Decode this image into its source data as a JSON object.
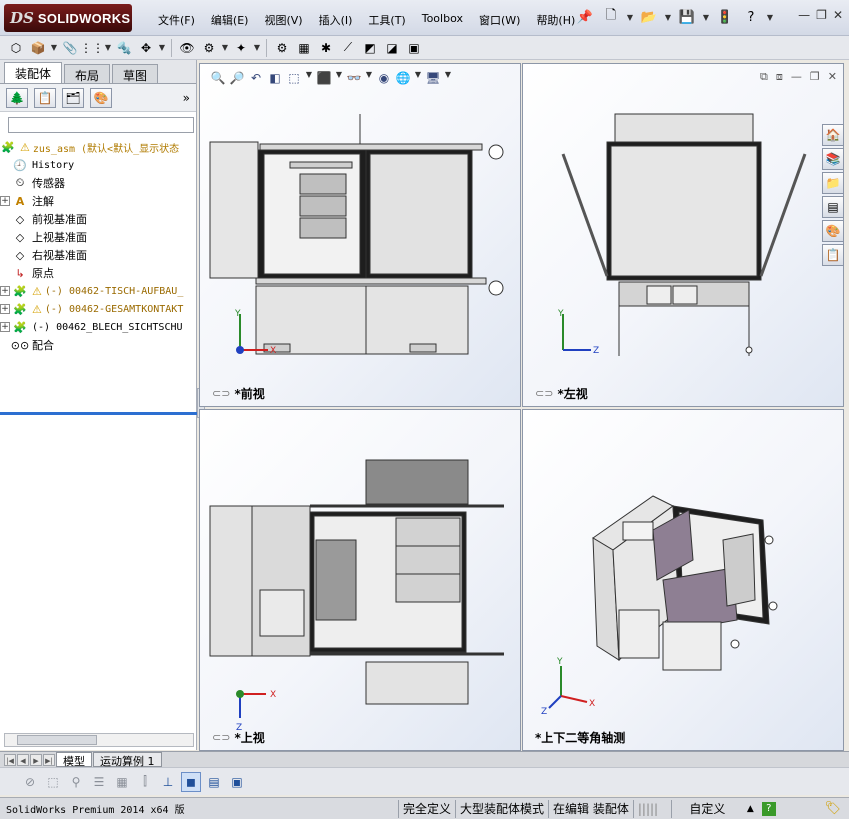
{
  "app": {
    "logo_ds": "DS",
    "logo_text": "SOLIDWORKS",
    "menu": [
      "文件(F)",
      "编辑(E)",
      "视图(V)",
      "插入(I)",
      "工具(T)",
      "Toolbox",
      "窗口(W)",
      "帮助(H)"
    ],
    "title_tool_icons": [
      "pin-icon",
      "new-doc-icon",
      "open-icon",
      "save-icon",
      "traffic-light-icon",
      "help-icon"
    ],
    "window_buttons": [
      "—",
      "❐",
      "✕"
    ]
  },
  "feature_manager": {
    "tabs": [
      "装配体",
      "布局",
      "草图"
    ],
    "active_tab": 0,
    "expand_symbol": "»",
    "tree": [
      {
        "label": "zus_asm  (默认<默认_显示状态",
        "kind": "root",
        "expand": false,
        "warn": true
      },
      {
        "label": "History",
        "kind": "history",
        "expand": false
      },
      {
        "label": "传感器",
        "kind": "sensor",
        "expand": false
      },
      {
        "label": "注解",
        "kind": "annotation",
        "expand": true
      },
      {
        "label": "前视基准面",
        "kind": "plane",
        "expand": false
      },
      {
        "label": "上视基准面",
        "kind": "plane",
        "expand": false
      },
      {
        "label": "右视基准面",
        "kind": "plane",
        "expand": false
      },
      {
        "label": "原点",
        "kind": "origin",
        "expand": false
      },
      {
        "label": "(-) 00462-TISCH-AUFBAU_",
        "kind": "subasm",
        "expand": true,
        "warn": true
      },
      {
        "label": "(-) 00462-GESAMTKONTAKT",
        "kind": "subasm",
        "expand": true,
        "warn": true
      },
      {
        "label": "(-) 00462_BLECH_SICHTSCHU",
        "kind": "subasm2",
        "expand": true,
        "warn": false
      },
      {
        "label": "配合",
        "kind": "mates",
        "expand": false
      }
    ]
  },
  "viewports": {
    "front_label": "*前视",
    "left_label": "*左视",
    "top_label": "*上视",
    "iso_label": "*上下二等角轴测",
    "axis_front": {
      "a": "Y",
      "b": "X"
    },
    "axis_left": {
      "a": "Y",
      "b": "Z"
    },
    "axis_top": {
      "a": "X",
      "b": "Z"
    },
    "axis_iso": {
      "a": "Y",
      "b": "X",
      "c": "Z"
    }
  },
  "bottom_tabs": [
    "模型",
    "运动算例 1"
  ],
  "active_bottom_tab": 0,
  "status": {
    "app_text": "SolidWorks Premium 2014 x64 版",
    "fully_defined": "完全定义",
    "large_mode": "大型装配体模式",
    "editing": "在编辑 装配体",
    "custom": "自定义",
    "help_badge": "?"
  },
  "colors": {
    "accent_blue": "#2c6fd1",
    "logo_red": "#7a1c1c",
    "warning_yellow": "#d4a000",
    "axis_y": "#2a8a2a",
    "axis_x": "#d02020",
    "axis_z": "#2040c0"
  }
}
